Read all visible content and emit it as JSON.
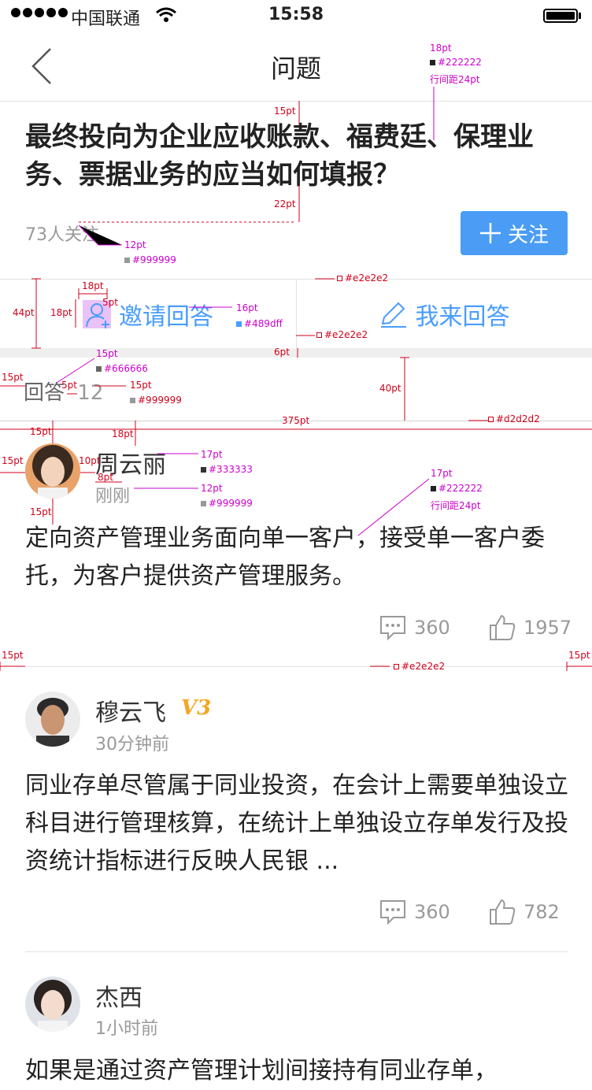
{
  "status_bar": {
    "carrier": "中国联通",
    "time": "15:58"
  },
  "nav": {
    "title": "问题"
  },
  "question": {
    "title": "最终投向为企业应收账款、福费廷、保理业务、票据业务的应当如何填报？",
    "follow_count": "73人关注",
    "follow_button": "关注"
  },
  "actions": {
    "invite": "邀请回答",
    "answer": "我来回答"
  },
  "answers_header": {
    "label": "回答",
    "count": "12"
  },
  "answers": [
    {
      "name": "周云丽",
      "time": "刚刚",
      "content": "定向资产管理业务面向单一客户，接受单一客户委托，为客户提供资产管理服务。",
      "comments": "360",
      "likes": "1957"
    },
    {
      "name": "穆云飞",
      "badge": "V3",
      "time": "30分钟前",
      "content": "同业存单尽管属于同业投资，在会计上需要单独设立科目进行管理核算，在统计上单独设立存单发行及投资统计指标进行反映人民银 ...",
      "comments": "360",
      "likes": "782"
    },
    {
      "name": "杰西",
      "time": "1小时前",
      "content": "如果是通过资产管理计划间接持有同业存单，"
    }
  ],
  "colors": {
    "primary": "#489dff",
    "follow_button": "#4a9cf5",
    "title": "#222222",
    "meta": "#999999",
    "divider": "#e2e2e2",
    "badge": "#f5a623"
  },
  "annotations": {
    "a1": "18pt",
    "a1c": "#222222",
    "a1l": "行间距24pt",
    "a2": "15pt",
    "a3": "22pt",
    "a4": "12pt",
    "a4c": "#999999",
    "a5": "#e2e2e2",
    "a6": "18pt",
    "a7": "5pt",
    "a8": "44pt",
    "a9": "18pt",
    "a10": "16pt",
    "a10c": "#489dff",
    "a11": "#e2e2e2",
    "a12": "6pt",
    "a13": "15pt",
    "a13c": "#666666",
    "a14": "15pt",
    "a15": "5pt",
    "a16": "15pt",
    "a16c": "#999999",
    "a17": "40pt",
    "a18": "375pt",
    "a19": "#d2d2d2",
    "a20": "15pt",
    "a21": "18pt",
    "a22": "15pt",
    "a23": "10pt",
    "a24": "17pt",
    "a24c": "#333333",
    "a25": "8pt",
    "a26": "12pt",
    "a26c": "#999999",
    "a27": "15pt",
    "a28": "17pt",
    "a28c": "#222222",
    "a28l": "行间距24pt",
    "a29": "15pt",
    "a30": "#e2e2e2",
    "a31": "15pt"
  }
}
